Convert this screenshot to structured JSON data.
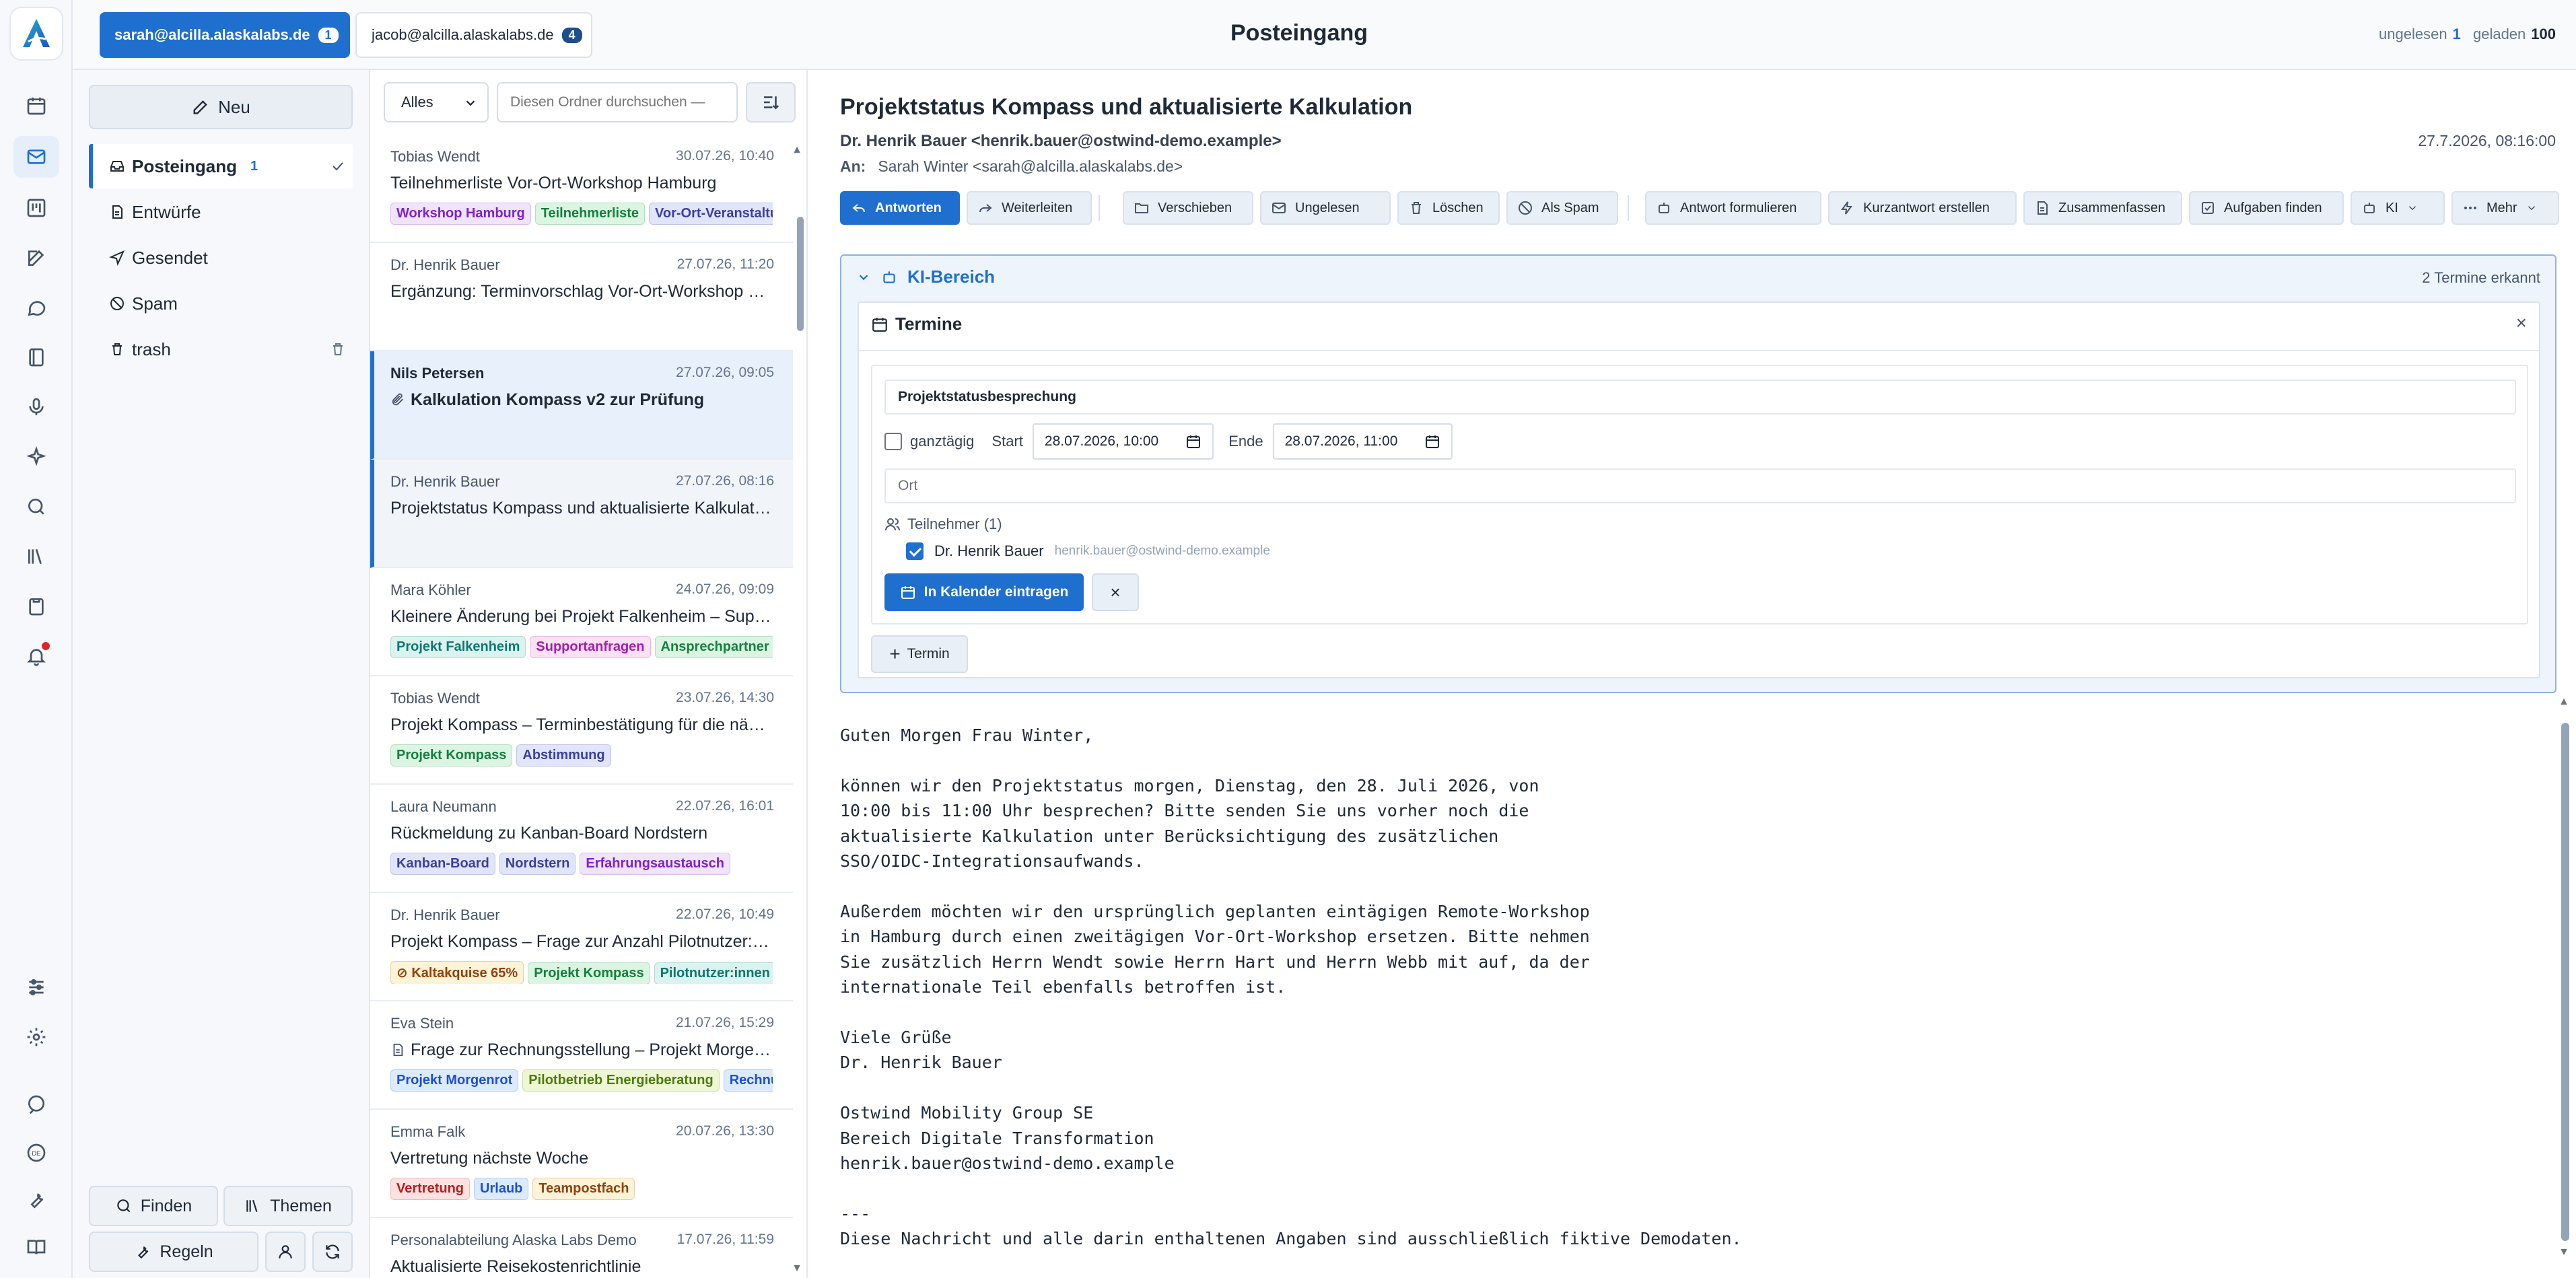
{
  "accounts": [
    {
      "email": "sarah@alcilla.alaskalabs.de",
      "count": "1"
    },
    {
      "email": "jacob@alcilla.alaskalabs.de",
      "count": "4"
    }
  ],
  "header": {
    "title": "Posteingang",
    "unread_label": "ungelesen",
    "unread": "1",
    "loaded_label": "geladen",
    "loaded": "100"
  },
  "folders": {
    "new_label": "Neu",
    "items": [
      {
        "label": "Posteingang",
        "count": "1"
      },
      {
        "label": "Entwürfe"
      },
      {
        "label": "Gesendet"
      },
      {
        "label": "Spam"
      },
      {
        "label": "trash"
      }
    ],
    "bottom": {
      "find": "Finden",
      "topics": "Themen",
      "rules": "Regeln"
    }
  },
  "list": {
    "filter_value": "Alles",
    "search_placeholder": "Diesen Ordner durchsuchen —",
    "messages": [
      {
        "from": "Tobias Wendt",
        "date": "30.07.26, 10:40",
        "subject": "Teilnehmerliste Vor-Ort-Workshop Hamburg",
        "tags": [
          {
            "t": "Workshop Hamburg",
            "c": "purple"
          },
          {
            "t": "Teilnehmerliste",
            "c": "green"
          },
          {
            "t": "Vor-Ort-Veranstaltung",
            "c": "indigo"
          }
        ]
      },
      {
        "from": "Dr. Henrik Bauer",
        "date": "27.07.26, 11:20",
        "subject": "Ergänzung: Terminvorschlag Vor-Ort-Workshop Hamburg",
        "tags": []
      },
      {
        "from": "Nils Petersen",
        "date": "27.07.26, 09:05",
        "subject": "Kalkulation Kompass v2 zur Prüfung",
        "tags": [],
        "bold": true,
        "attach": true
      },
      {
        "from": "Dr. Henrik Bauer",
        "date": "27.07.26, 08:16",
        "subject": "Projektstatus Kompass und aktualisierte Kalkulation",
        "tags": []
      },
      {
        "from": "Mara Köhler",
        "date": "24.07.26, 09:09",
        "subject": "Kleinere Änderung bei Projekt Falkenheim – Supportanfrage",
        "tags": [
          {
            "t": "Projekt Falkenheim",
            "c": "teal"
          },
          {
            "t": "Supportanfragen",
            "c": "pink"
          },
          {
            "t": "Ansprechpartner",
            "c": "green"
          }
        ]
      },
      {
        "from": "Tobias Wendt",
        "date": "23.07.26, 14:30",
        "subject": "Projekt Kompass – Terminbestätigung für die nächste Woche",
        "tags": [
          {
            "t": "Projekt Kompass",
            "c": "green"
          },
          {
            "t": "Abstimmung",
            "c": "indigo"
          }
        ]
      },
      {
        "from": "Laura Neumann",
        "date": "22.07.26, 16:01",
        "subject": "Rückmeldung zu Kanban-Board Nordstern",
        "tags": [
          {
            "t": "Kanban-Board",
            "c": "indigo"
          },
          {
            "t": "Nordstern",
            "c": "indigo"
          },
          {
            "t": "Erfahrungsaustausch",
            "c": "purple"
          }
        ]
      },
      {
        "from": "Dr. Henrik Bauer",
        "date": "22.07.26, 10:49",
        "subject": "Projekt Kompass – Frage zur Anzahl Pilotnutzer:innen",
        "tags": [
          {
            "t": "Kaltakquise 65%",
            "c": "amber"
          },
          {
            "t": "Projekt Kompass",
            "c": "green"
          },
          {
            "t": "Pilotnutzer:innen",
            "c": "teal"
          }
        ]
      },
      {
        "from": "Eva Stein",
        "date": "21.07.26, 15:29",
        "subject": "Frage zur Rechnungsstellung – Projekt Morgenrot",
        "doc": true,
        "tags": [
          {
            "t": "Projekt Morgenrot",
            "c": "blue"
          },
          {
            "t": "Pilotbetrieb Energieberatung",
            "c": "lime"
          },
          {
            "t": "Rechnung",
            "c": "blue"
          }
        ]
      },
      {
        "from": "Emma Falk",
        "date": "20.07.26, 13:30",
        "subject": "Vertretung nächste Woche",
        "tags": [
          {
            "t": "Vertretung",
            "c": "red"
          },
          {
            "t": "Urlaub",
            "c": "blue"
          },
          {
            "t": "Teampostfach",
            "c": "amber"
          }
        ]
      },
      {
        "from": "Personalabteilung Alaska Labs Demo",
        "date": "17.07.26, 11:59",
        "subject": "Aktualisierte Reisekostenrichtlinie",
        "tags": []
      }
    ]
  },
  "reader": {
    "subject": "Projektstatus Kompass und aktualisierte Kalkulation",
    "sender": "Dr. Henrik Bauer <henrik.bauer@ostwind-demo.example>",
    "date": "27.7.2026, 08:16:00",
    "to_label": "An:",
    "to": "Sarah Winter <sarah@alcilla.alaskalabs.de>",
    "toolbar": {
      "reply": "Antworten",
      "forward": "Weiterleiten",
      "move": "Verschieben",
      "unread": "Ungelesen",
      "delete": "Löschen",
      "spam": "Als Spam",
      "draft": "Antwort formulieren",
      "quick": "Kurzantwort erstellen",
      "summary": "Zusammenfassen",
      "tasks": "Aufgaben finden",
      "ki": "KI",
      "more": "Mehr"
    },
    "ki": {
      "title": "KI-Bereich",
      "count": "2 Termine erkannt",
      "panel_title": "Termine",
      "event_title": "Projektstatusbesprechung",
      "allday": "ganztägig",
      "start_label": "Start",
      "start": "28.07.2026, 10:00",
      "end_label": "Ende",
      "end": "28.07.2026, 11:00",
      "location_placeholder": "Ort",
      "participants_label": "Teilnehmer (1)",
      "participant_name": "Dr. Henrik Bauer",
      "participant_email": "henrik.bauer@ostwind-demo.example",
      "add_calendar": "In Kalender eintragen",
      "add_termin": "Termin"
    },
    "body": "Guten Morgen Frau Winter,\n\nkönnen wir den Projektstatus morgen, Dienstag, den 28. Juli 2026, von\n10:00 bis 11:00 Uhr besprechen? Bitte senden Sie uns vorher noch die\naktualisierte Kalkulation unter Berücksichtigung des zusätzlichen\nSSO/OIDC-Integrationsaufwands.\n\nAußerdem möchten wir den ursprünglich geplanten eintägigen Remote-Workshop\nin Hamburg durch einen zweitägigen Vor-Ort-Workshop ersetzen. Bitte nehmen\nSie zusätzlich Herrn Wendt sowie Herrn Hart und Herrn Webb mit auf, da der\ninternationale Teil ebenfalls betroffen ist.\n\nViele Grüße\nDr. Henrik Bauer\n\nOstwind Mobility Group SE\nBereich Digitale Transformation\nhenrik.bauer@ostwind-demo.example\n\n---\nDiese Nachricht und alle darin enthaltenen Angaben sind ausschließlich fiktive Demodaten."
  },
  "tag_colors": {
    "purple": [
      "#efe4fb",
      "#7e22ce"
    ],
    "green": [
      "#dcf5e3",
      "#15803d"
    ],
    "indigo": [
      "#e1e5fa",
      "#3b3f9e"
    ],
    "teal": [
      "#d9f3ef",
      "#0f766e"
    ],
    "pink": [
      "#fbe1f3",
      "#a21caf"
    ],
    "amber": [
      "#fdf3d6",
      "#92400e"
    ],
    "blue": [
      "#dcebfb",
      "#1d4ed8"
    ],
    "lime": [
      "#eef7d3",
      "#4d7c0f"
    ],
    "red": [
      "#fde1e1",
      "#b91c1c"
    ]
  }
}
